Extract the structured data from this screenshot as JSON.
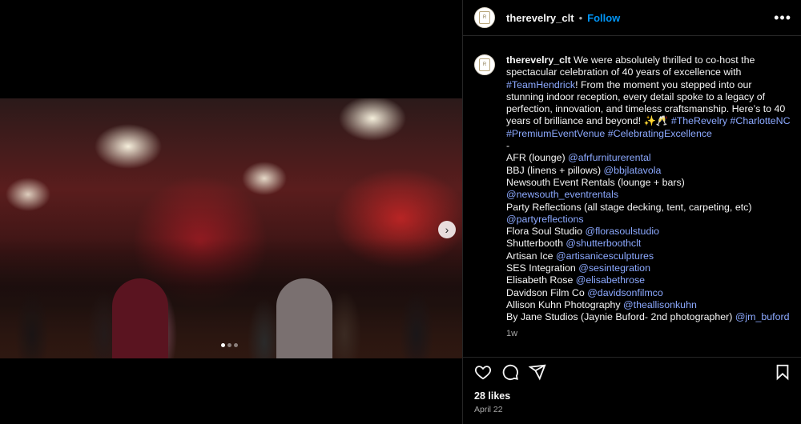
{
  "post": {
    "username": "therevelry_clt",
    "follow_label": "Follow",
    "header_sep": "•",
    "more_label": "•••",
    "avatar_logo": "R",
    "caption_lines": [
      [
        {
          "t": "therevelry_clt",
          "k": "user"
        },
        {
          "t": " We were absolutely thrilled to co-host the"
        }
      ],
      [
        {
          "t": "spectacular celebration of 40 years of excellence with"
        }
      ],
      [
        {
          "t": "#TeamHendrick",
          "k": "link"
        },
        {
          "t": "! From the moment you stepped into our"
        }
      ],
      [
        {
          "t": "stunning indoor reception, every detail spoke to a legacy of"
        }
      ],
      [
        {
          "t": "perfection, innovation, and timeless craftsmanship. Here’s to 40"
        }
      ],
      [
        {
          "t": "years of brilliance and beyond! ✨🥂 "
        },
        {
          "t": "#TheRevelry",
          "k": "link"
        },
        {
          "t": " "
        },
        {
          "t": "#CharlotteNC",
          "k": "link"
        }
      ],
      [
        {
          "t": "#PremiumEventVenue",
          "k": "link"
        },
        {
          "t": " "
        },
        {
          "t": "#CelebratingExcellence",
          "k": "link"
        }
      ],
      [
        {
          "t": "-"
        }
      ],
      [
        {
          "t": "AFR (lounge) "
        },
        {
          "t": "@afrfurniturerental",
          "k": "link"
        }
      ],
      [
        {
          "t": "BBJ (linens + pillows) "
        },
        {
          "t": "@bbjlatavola",
          "k": "link"
        }
      ],
      [
        {
          "t": "Newsouth Event Rentals (lounge + bars)"
        }
      ],
      [
        {
          "t": "@newsouth_eventrentals",
          "k": "link"
        }
      ],
      [
        {
          "t": "Party Reflections (all stage decking, tent, carpeting, etc)"
        }
      ],
      [
        {
          "t": "@partyreflections",
          "k": "link"
        }
      ],
      [
        {
          "t": "Flora Soul Studio "
        },
        {
          "t": "@florasoulstudio",
          "k": "link"
        }
      ],
      [
        {
          "t": "Shutterbooth "
        },
        {
          "t": "@shutterboothclt",
          "k": "link"
        }
      ],
      [
        {
          "t": "Artisan Ice "
        },
        {
          "t": "@artisanicesculptures",
          "k": "link"
        }
      ],
      [
        {
          "t": "SES Integration "
        },
        {
          "t": "@sesintegration",
          "k": "link"
        }
      ],
      [
        {
          "t": "Elisabeth Rose "
        },
        {
          "t": "@elisabethrose",
          "k": "link"
        }
      ],
      [
        {
          "t": "Davidson Film Co "
        },
        {
          "t": "@davidsonfilmco",
          "k": "link"
        }
      ],
      [
        {
          "t": "Allison Kuhn Photography "
        },
        {
          "t": "@theallisonkuhn",
          "k": "link"
        }
      ],
      [
        {
          "t": "By Jane Studios (Jaynie Buford- 2nd photographer) "
        },
        {
          "t": "@jm_buford",
          "k": "link"
        }
      ]
    ],
    "time_ago": "1w",
    "likes": "28 likes",
    "date": "April 22"
  },
  "carousel": {
    "next_glyph": "›",
    "dot_count": 3,
    "active_dot": 0
  },
  "icons": {
    "like": "heart-icon",
    "comment": "comment-icon",
    "share": "share-icon",
    "save": "bookmark-icon"
  }
}
